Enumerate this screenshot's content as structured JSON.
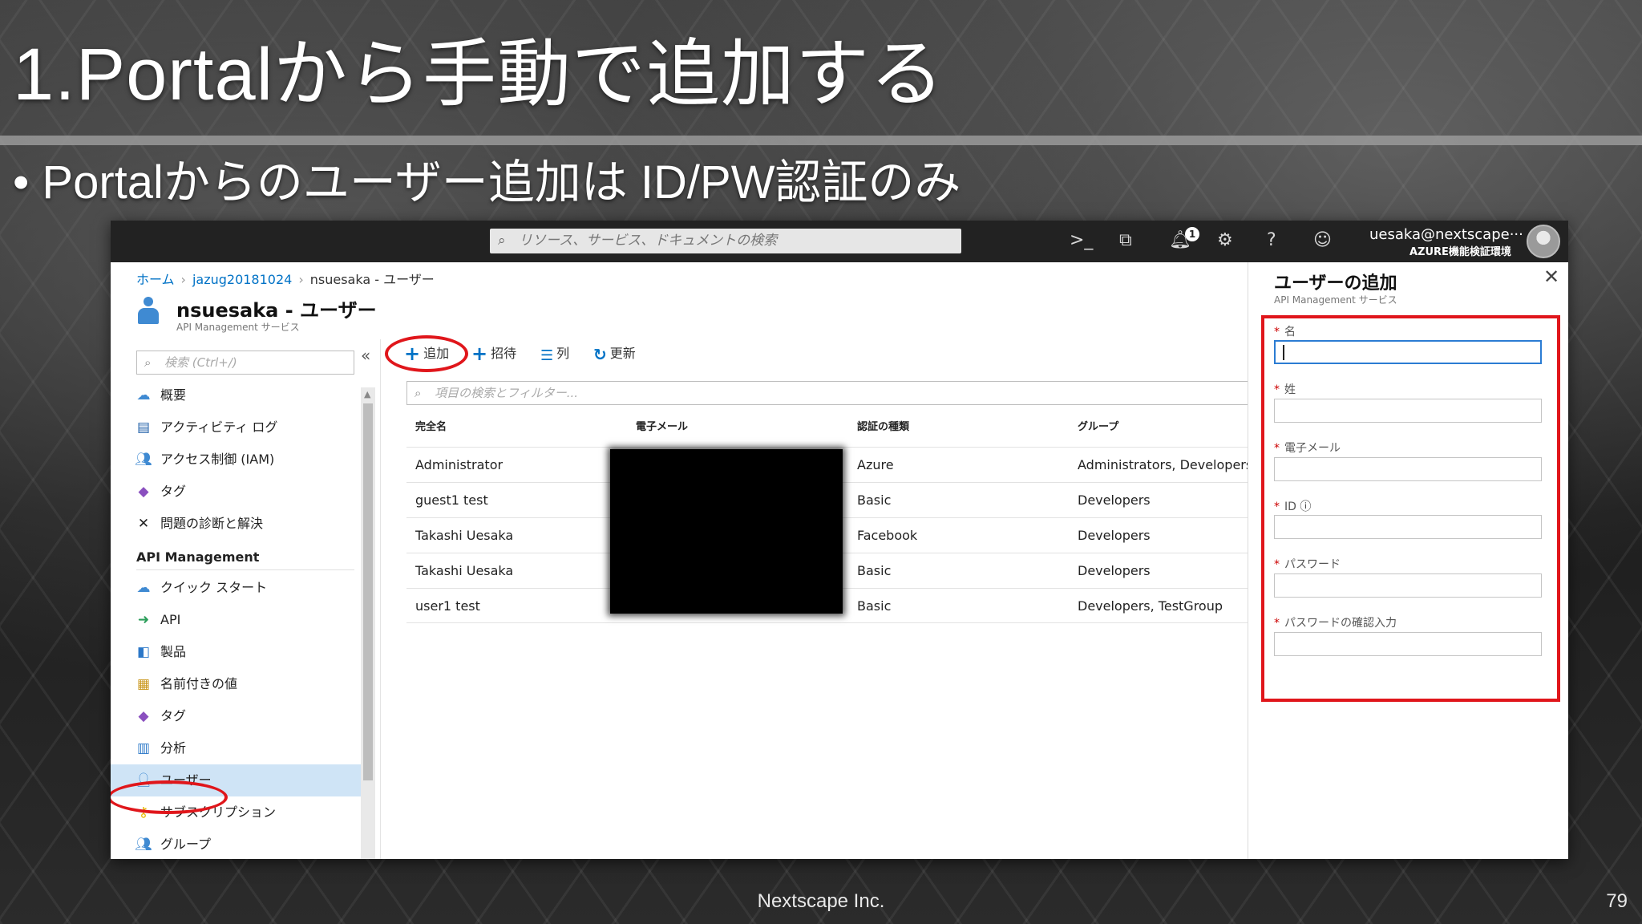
{
  "slide": {
    "title": "1.Portalから手動で追加する",
    "bullet": "• Portalからのユーザー追加は ID/PW認証のみ",
    "footer": "Nextscape Inc.",
    "page_number": "79"
  },
  "topbar": {
    "search_placeholder": "リソース、サービス、ドキュメントの検索",
    "notification_count": "1",
    "user_email": "uesaka@nextscape···",
    "tenant": "AZURE機能検証環境"
  },
  "breadcrumb": {
    "home": "ホーム",
    "resource": "jazug20181024",
    "current": "nsuesaka - ユーザー"
  },
  "blade": {
    "title": "nsuesaka - ユーザー",
    "subtitle": "API Management サービス"
  },
  "nav": {
    "search_placeholder": "検索 (Ctrl+/)",
    "collapse": "«",
    "items_top": [
      {
        "label": "概要",
        "icon": "cloud-icon"
      },
      {
        "label": "アクティビティ ログ",
        "icon": "log-icon"
      },
      {
        "label": "アクセス制御 (IAM)",
        "icon": "people-icon"
      },
      {
        "label": "タグ",
        "icon": "tag-icon"
      },
      {
        "label": "問題の診断と解決",
        "icon": "wrench-icon"
      }
    ],
    "section": "API Management",
    "items_api": [
      {
        "label": "クイック スタート",
        "icon": "cloud-icon"
      },
      {
        "label": "API",
        "icon": "arrow-icon"
      },
      {
        "label": "製品",
        "icon": "box-icon"
      },
      {
        "label": "名前付きの値",
        "icon": "table-icon"
      },
      {
        "label": "タグ",
        "icon": "tag-icon"
      },
      {
        "label": "分析",
        "icon": "chart-icon"
      },
      {
        "label": "ユーザー",
        "icon": "user-icon"
      },
      {
        "label": "サブスクリプション",
        "icon": "key-icon"
      },
      {
        "label": "グループ",
        "icon": "group-icon"
      }
    ]
  },
  "toolbar": {
    "add": "追加",
    "invite": "招待",
    "columns": "列",
    "refresh": "更新"
  },
  "filter_placeholder": "項目の検索とフィルター...",
  "table": {
    "headers": [
      "完全名",
      "電子メール",
      "認証の種類",
      "グループ"
    ],
    "rows": [
      [
        "Administrator",
        "",
        "Azure",
        "Administrators, Developers"
      ],
      [
        "guest1 test",
        "",
        "Basic",
        "Developers"
      ],
      [
        "Takashi Uesaka",
        "",
        "Facebook",
        "Developers"
      ],
      [
        "Takashi Uesaka",
        "",
        "Basic",
        "Developers"
      ],
      [
        "user1 test",
        "",
        "Basic",
        "Developers, TestGroup"
      ]
    ]
  },
  "panel": {
    "title": "ユーザーの追加",
    "subtitle": "API Management サービス",
    "close": "✕",
    "required_mark": "*",
    "fields": [
      "名",
      "姓",
      "電子メール",
      "ID",
      "パスワード",
      "パスワードの確認入力"
    ]
  },
  "colors": {
    "highlight": "#e0161b",
    "accent": "#0072c6",
    "active_nav": "#cfe4f6"
  }
}
